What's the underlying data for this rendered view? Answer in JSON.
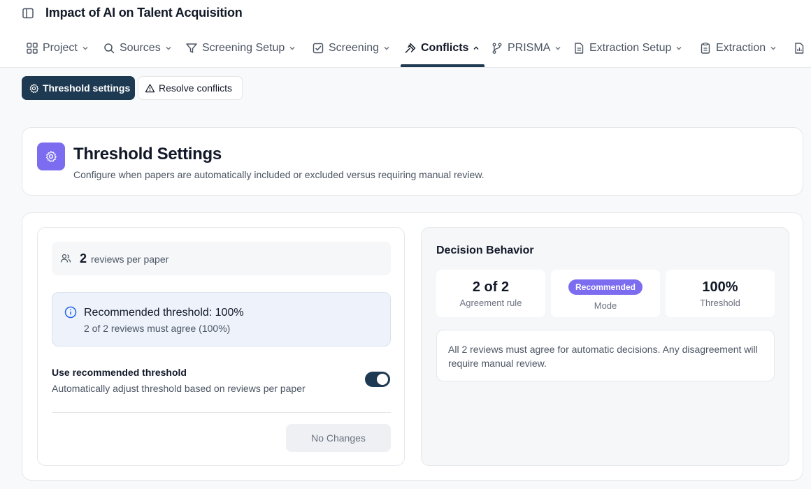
{
  "app": {
    "title": "Impact of AI on Talent Acquisition"
  },
  "nav": {
    "tabs": [
      {
        "label": "Project",
        "icon": "grid-icon"
      },
      {
        "label": "Sources",
        "icon": "search-icon"
      },
      {
        "label": "Screening Setup",
        "icon": "filter-icon"
      },
      {
        "label": "Screening",
        "icon": "checkbox-icon"
      },
      {
        "label": "Conflicts",
        "icon": "gavel-icon",
        "active": true
      },
      {
        "label": "PRISMA",
        "icon": "branch-icon"
      },
      {
        "label": "Extraction Setup",
        "icon": "document-icon"
      },
      {
        "label": "Extraction",
        "icon": "clipboard-icon"
      }
    ]
  },
  "subnav": {
    "threshold_label": "Threshold settings",
    "resolve_label": "Resolve conflicts"
  },
  "header": {
    "title": "Threshold Settings",
    "description": "Configure when papers are automatically included or excluded versus requiring manual review."
  },
  "left": {
    "reviews_count": "2",
    "reviews_label": "reviews per paper",
    "recommended_title": "Recommended threshold: 100%",
    "recommended_sub": "2 of 2 reviews must agree (100%)",
    "use_recommended_title": "Use recommended threshold",
    "use_recommended_desc": "Automatically adjust threshold based on reviews per paper",
    "toggle_on": true,
    "no_changes_label": "No Changes"
  },
  "right": {
    "title": "Decision Behavior",
    "agreement_value": "2 of 2",
    "agreement_label": "Agreement rule",
    "mode_badge": "Recommended",
    "mode_label": "Mode",
    "threshold_value": "100%",
    "threshold_label": "Threshold",
    "info": "All 2 reviews must agree for automatic decisions. Any disagreement will require manual review."
  },
  "colors": {
    "primary": "#1e3a52",
    "accent": "#7c6cf0",
    "info_bg": "#eef3fb"
  }
}
